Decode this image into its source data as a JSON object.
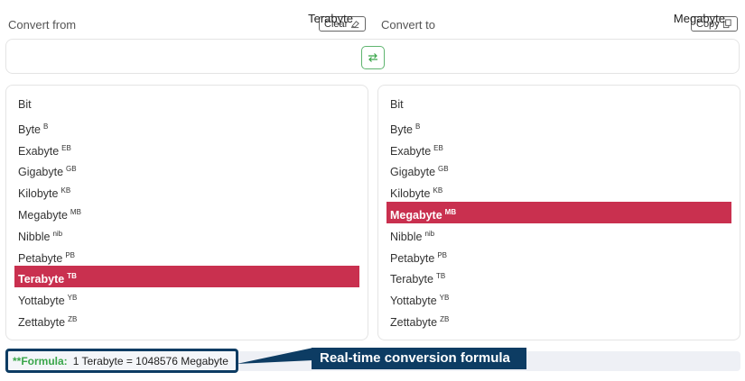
{
  "from_header": {
    "label": "Convert from",
    "clear_label": "Clear"
  },
  "to_header": {
    "label": "Convert to",
    "copy_label": "Copy"
  },
  "unit_bar": {
    "from_unit": "Terabyte",
    "to_unit": "Megabyte"
  },
  "from_list": {
    "items": [
      {
        "name": "Bit",
        "abbr": ""
      },
      {
        "name": "Byte",
        "abbr": "B"
      },
      {
        "name": "Exabyte",
        "abbr": "EB"
      },
      {
        "name": "Gigabyte",
        "abbr": "GB"
      },
      {
        "name": "Kilobyte",
        "abbr": "KB"
      },
      {
        "name": "Megabyte",
        "abbr": "MB"
      },
      {
        "name": "Nibble",
        "abbr": "nib"
      },
      {
        "name": "Petabyte",
        "abbr": "PB"
      },
      {
        "name": "Terabyte",
        "abbr": "TB"
      },
      {
        "name": "Yottabyte",
        "abbr": "YB"
      },
      {
        "name": "Zettabyte",
        "abbr": "ZB"
      }
    ],
    "selected": "Terabyte"
  },
  "to_list": {
    "items": [
      {
        "name": "Bit",
        "abbr": ""
      },
      {
        "name": "Byte",
        "abbr": "B"
      },
      {
        "name": "Exabyte",
        "abbr": "EB"
      },
      {
        "name": "Gigabyte",
        "abbr": "GB"
      },
      {
        "name": "Kilobyte",
        "abbr": "KB"
      },
      {
        "name": "Megabyte",
        "abbr": "MB"
      },
      {
        "name": "Nibble",
        "abbr": "nib"
      },
      {
        "name": "Petabyte",
        "abbr": "PB"
      },
      {
        "name": "Terabyte",
        "abbr": "TB"
      },
      {
        "name": "Yottabyte",
        "abbr": "YB"
      },
      {
        "name": "Zettabyte",
        "abbr": "ZB"
      }
    ],
    "selected": "Megabyte"
  },
  "formula": {
    "label": "**Formula:",
    "text": "1 Terabyte = 1048576 Megabyte"
  },
  "annotation": {
    "callout": "Real-time conversion formula"
  },
  "icons": {
    "clear": "eraser-icon",
    "copy": "copy-icon",
    "swap": "swap-arrows-icon"
  },
  "colors": {
    "selected_bg": "#c9304f",
    "accent_green": "#3aa64a",
    "callout_navy": "#0d3c63"
  }
}
